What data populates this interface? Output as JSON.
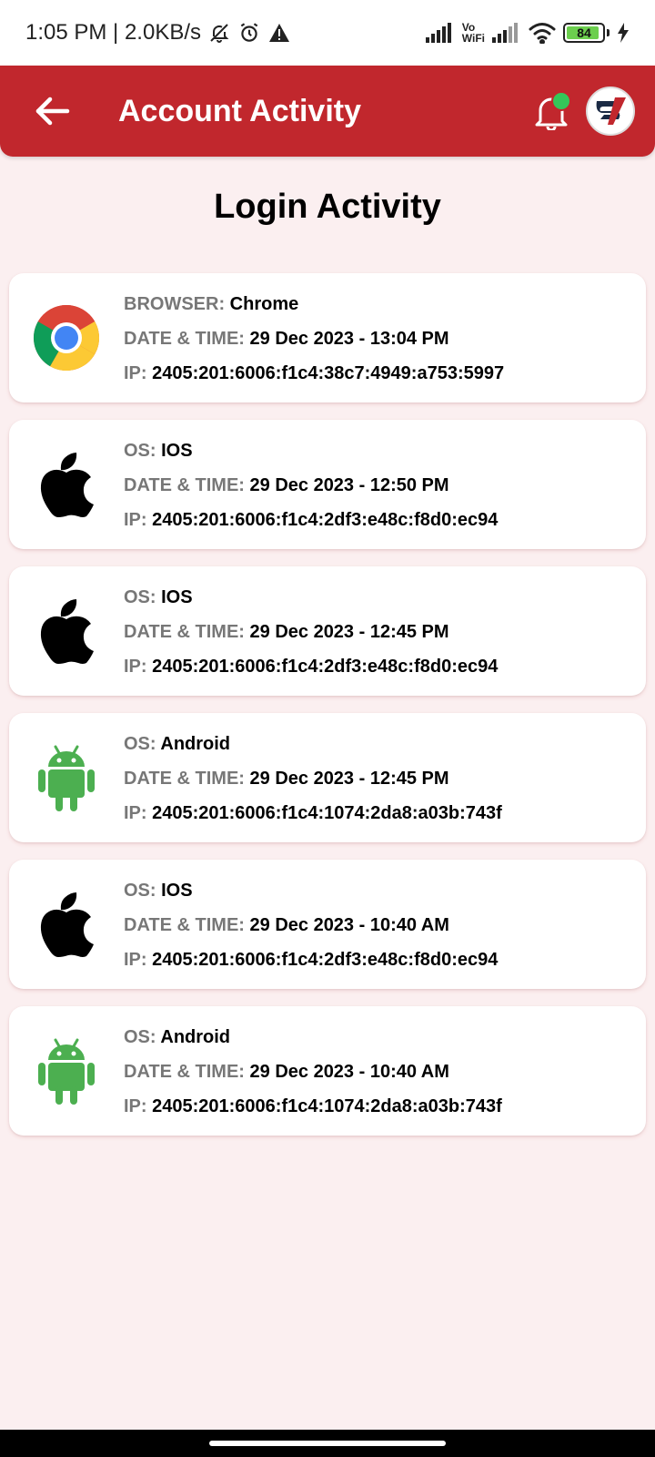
{
  "status_bar": {
    "time_speed": "1:05 PM | 2.0KB/s",
    "vowifi_top": "Vo",
    "vowifi_bottom": "WiFi",
    "battery": "84"
  },
  "app_bar": {
    "title": "Account Activity",
    "brand_color": "#c1272d",
    "notification_dot_color": "#34c759"
  },
  "page": {
    "heading": "Login Activity"
  },
  "labels": {
    "browser": "BROWSER:",
    "os": "OS:",
    "date_time": "DATE & TIME:",
    "ip": "IP:"
  },
  "entries": [
    {
      "icon": "chrome-icon",
      "type_label": "BROWSER:",
      "type_value": "Chrome",
      "date_time": "29 Dec 2023 - 13:04 PM",
      "ip": "2405:201:6006:f1c4:38c7:4949:a753:5997"
    },
    {
      "icon": "apple-icon",
      "type_label": "OS:",
      "type_value": "IOS",
      "date_time": "29 Dec 2023 - 12:50 PM",
      "ip": "2405:201:6006:f1c4:2df3:e48c:f8d0:ec94"
    },
    {
      "icon": "apple-icon",
      "type_label": "OS:",
      "type_value": "IOS",
      "date_time": "29 Dec 2023 - 12:45 PM",
      "ip": "2405:201:6006:f1c4:2df3:e48c:f8d0:ec94"
    },
    {
      "icon": "android-icon",
      "type_label": "OS:",
      "type_value": "Android",
      "date_time": "29 Dec 2023 - 12:45 PM",
      "ip": "2405:201:6006:f1c4:1074:2da8:a03b:743f"
    },
    {
      "icon": "apple-icon",
      "type_label": "OS:",
      "type_value": "IOS",
      "date_time": "29 Dec 2023 - 10:40 AM",
      "ip": "2405:201:6006:f1c4:2df3:e48c:f8d0:ec94"
    },
    {
      "icon": "android-icon",
      "type_label": "OS:",
      "type_value": "Android",
      "date_time": "29 Dec 2023 - 10:40 AM",
      "ip": "2405:201:6006:f1c4:1074:2da8:a03b:743f"
    }
  ]
}
